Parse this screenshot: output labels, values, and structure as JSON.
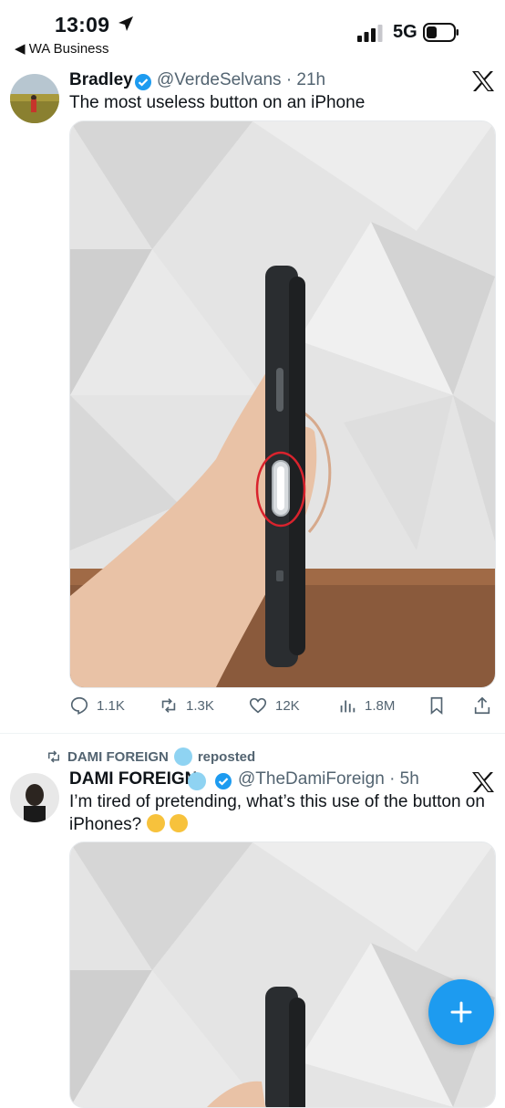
{
  "status_bar": {
    "time": "13:09",
    "back_label": "◀ WA Business",
    "network": "5G"
  },
  "tweet1": {
    "name": "Bradley",
    "handle": "@VerdeSelvans · 21h",
    "text": "The most useless button on an iPhone",
    "replies": "1.1K",
    "reposts": "1.3K",
    "likes": "12K",
    "views": "1.8M"
  },
  "tweet2": {
    "repost_label": "DAMI FOREIGN",
    "repost_suffix": "reposted",
    "name": "DAMI FOREIGN",
    "handle": "@TheDamiForeign · 5h",
    "text": "I’m tired of pretending, what’s this use of the button on iPhones?"
  },
  "colors": {
    "accent": "#1d9bf0",
    "secondary_text": "#536471",
    "highlight_circle": "#d9232d"
  },
  "icons": [
    "location-arrow-icon",
    "signal-icon",
    "battery-icon",
    "verified-badge-icon",
    "x-logo-icon",
    "reply-icon",
    "repost-icon",
    "like-icon",
    "views-icon",
    "bookmark-icon",
    "share-icon",
    "compose-plus-icon"
  ]
}
